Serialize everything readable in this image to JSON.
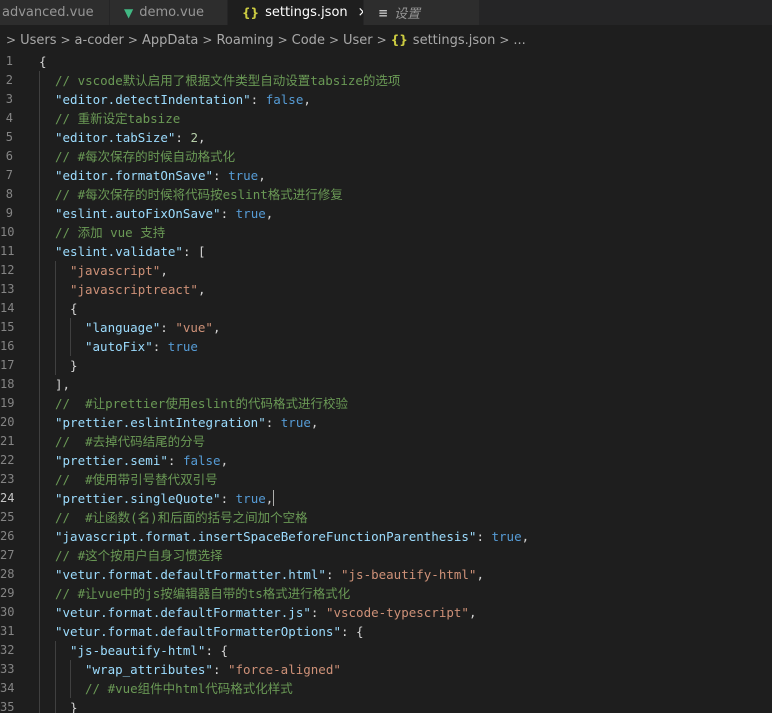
{
  "tabs": [
    {
      "label": "advanced.vue",
      "icon": "none"
    },
    {
      "label": "demo.vue",
      "icon": "vue-icon"
    },
    {
      "label": "settings.json",
      "icon": "json-braces-icon",
      "active": true,
      "close": "×"
    },
    {
      "label": "设置",
      "icon": "settings-list-icon"
    }
  ],
  "breadcrumb": {
    "lead_sep": ">",
    "items": [
      "Users",
      "a-coder",
      "AppData",
      "Roaming",
      "Code",
      "User",
      "settings.json",
      "..."
    ]
  },
  "editor": {
    "active_line": 24,
    "lines": [
      {
        "n": "1",
        "t": [
          [
            "p",
            "{"
          ]
        ]
      },
      {
        "n": "2",
        "t": [
          [
            "c",
            "// vscode默认启用了根据文件类型自动设置tabsize的选项"
          ]
        ]
      },
      {
        "n": "3",
        "t": [
          [
            "k",
            "\"editor.detectIndentation\""
          ],
          [
            "p",
            ": "
          ],
          [
            "b",
            "false"
          ],
          [
            "p",
            ","
          ]
        ]
      },
      {
        "n": "4",
        "t": [
          [
            "c",
            "// 重新设定tabsize"
          ]
        ]
      },
      {
        "n": "5",
        "t": [
          [
            "k",
            "\"editor.tabSize\""
          ],
          [
            "p",
            ": "
          ],
          [
            "n",
            "2"
          ],
          [
            "p",
            ","
          ]
        ]
      },
      {
        "n": "6",
        "t": [
          [
            "c",
            "// #每次保存的时候自动格式化"
          ]
        ]
      },
      {
        "n": "7",
        "t": [
          [
            "k",
            "\"editor.formatOnSave\""
          ],
          [
            "p",
            ": "
          ],
          [
            "b",
            "true"
          ],
          [
            "p",
            ","
          ]
        ]
      },
      {
        "n": "8",
        "t": [
          [
            "c",
            "// #每次保存的时候将代码按eslint格式进行修复"
          ]
        ]
      },
      {
        "n": "9",
        "t": [
          [
            "k",
            "\"eslint.autoFixOnSave\""
          ],
          [
            "p",
            ": "
          ],
          [
            "b",
            "true"
          ],
          [
            "p",
            ","
          ]
        ]
      },
      {
        "n": "10",
        "t": [
          [
            "c",
            "// 添加 vue 支持"
          ]
        ]
      },
      {
        "n": "11",
        "t": [
          [
            "k",
            "\"eslint.validate\""
          ],
          [
            "p",
            ": ["
          ]
        ]
      },
      {
        "n": "12",
        "t": [
          [
            "s",
            "\"javascript\""
          ],
          [
            "p",
            ","
          ]
        ]
      },
      {
        "n": "13",
        "t": [
          [
            "s",
            "\"javascriptreact\""
          ],
          [
            "p",
            ","
          ]
        ]
      },
      {
        "n": "14",
        "t": [
          [
            "p",
            "{"
          ]
        ]
      },
      {
        "n": "15",
        "t": [
          [
            "k",
            "\"language\""
          ],
          [
            "p",
            ": "
          ],
          [
            "s",
            "\"vue\""
          ],
          [
            "p",
            ","
          ]
        ]
      },
      {
        "n": "16",
        "t": [
          [
            "k",
            "\"autoFix\""
          ],
          [
            "p",
            ": "
          ],
          [
            "b",
            "true"
          ]
        ]
      },
      {
        "n": "17",
        "t": [
          [
            "p",
            "}"
          ]
        ]
      },
      {
        "n": "18",
        "t": [
          [
            "p",
            "],"
          ]
        ]
      },
      {
        "n": "19",
        "t": [
          [
            "c",
            "//  #让prettier使用eslint的代码格式进行校验"
          ]
        ]
      },
      {
        "n": "20",
        "t": [
          [
            "k",
            "\"prettier.eslintIntegration\""
          ],
          [
            "p",
            ": "
          ],
          [
            "b",
            "true"
          ],
          [
            "p",
            ","
          ]
        ]
      },
      {
        "n": "21",
        "t": [
          [
            "c",
            "//  #去掉代码结尾的分号"
          ]
        ]
      },
      {
        "n": "22",
        "t": [
          [
            "k",
            "\"prettier.semi\""
          ],
          [
            "p",
            ": "
          ],
          [
            "b",
            "false"
          ],
          [
            "p",
            ","
          ]
        ]
      },
      {
        "n": "23",
        "t": [
          [
            "c",
            "//  #使用带引号替代双引号"
          ]
        ]
      },
      {
        "n": "24",
        "t": [
          [
            "k",
            "\"prettier.singleQuote\""
          ],
          [
            "p",
            ": "
          ],
          [
            "b",
            "true"
          ],
          [
            "p",
            ","
          ]
        ]
      },
      {
        "n": "25",
        "t": [
          [
            "c",
            "//  #让函数(名)和后面的括号之间加个空格"
          ]
        ]
      },
      {
        "n": "26",
        "t": [
          [
            "k",
            "\"javascript.format.insertSpaceBeforeFunctionParenthesis\""
          ],
          [
            "p",
            ": "
          ],
          [
            "b",
            "true"
          ],
          [
            "p",
            ","
          ]
        ]
      },
      {
        "n": "27",
        "t": [
          [
            "c",
            "// #这个按用户自身习惯选择"
          ]
        ]
      },
      {
        "n": "28",
        "t": [
          [
            "k",
            "\"vetur.format.defaultFormatter.html\""
          ],
          [
            "p",
            ": "
          ],
          [
            "s",
            "\"js-beautify-html\""
          ],
          [
            "p",
            ","
          ]
        ]
      },
      {
        "n": "29",
        "t": [
          [
            "c",
            "// #让vue中的js按编辑器自带的ts格式进行格式化"
          ]
        ]
      },
      {
        "n": "30",
        "t": [
          [
            "k",
            "\"vetur.format.defaultFormatter.js\""
          ],
          [
            "p",
            ": "
          ],
          [
            "s",
            "\"vscode-typescript\""
          ],
          [
            "p",
            ","
          ]
        ]
      },
      {
        "n": "31",
        "t": [
          [
            "k",
            "\"vetur.format.defaultFormatterOptions\""
          ],
          [
            "p",
            ": {"
          ]
        ]
      },
      {
        "n": "32",
        "t": [
          [
            "k",
            "\"js-beautify-html\""
          ],
          [
            "p",
            ": {"
          ]
        ]
      },
      {
        "n": "33",
        "t": [
          [
            "k",
            "\"wrap_attributes\""
          ],
          [
            "p",
            ": "
          ],
          [
            "s",
            "\"force-aligned\""
          ]
        ]
      },
      {
        "n": "34",
        "t": [
          [
            "c",
            "// #vue组件中html代码格式化样式"
          ]
        ]
      },
      {
        "n": "35",
        "t": [
          [
            "p",
            "}"
          ]
        ]
      }
    ]
  },
  "colors": {
    "background": "#1e1e1e",
    "key": "#9cdcfe",
    "string": "#ce9178",
    "boolean": "#569cd6",
    "number": "#b5cea8",
    "comment": "#6a9955"
  }
}
